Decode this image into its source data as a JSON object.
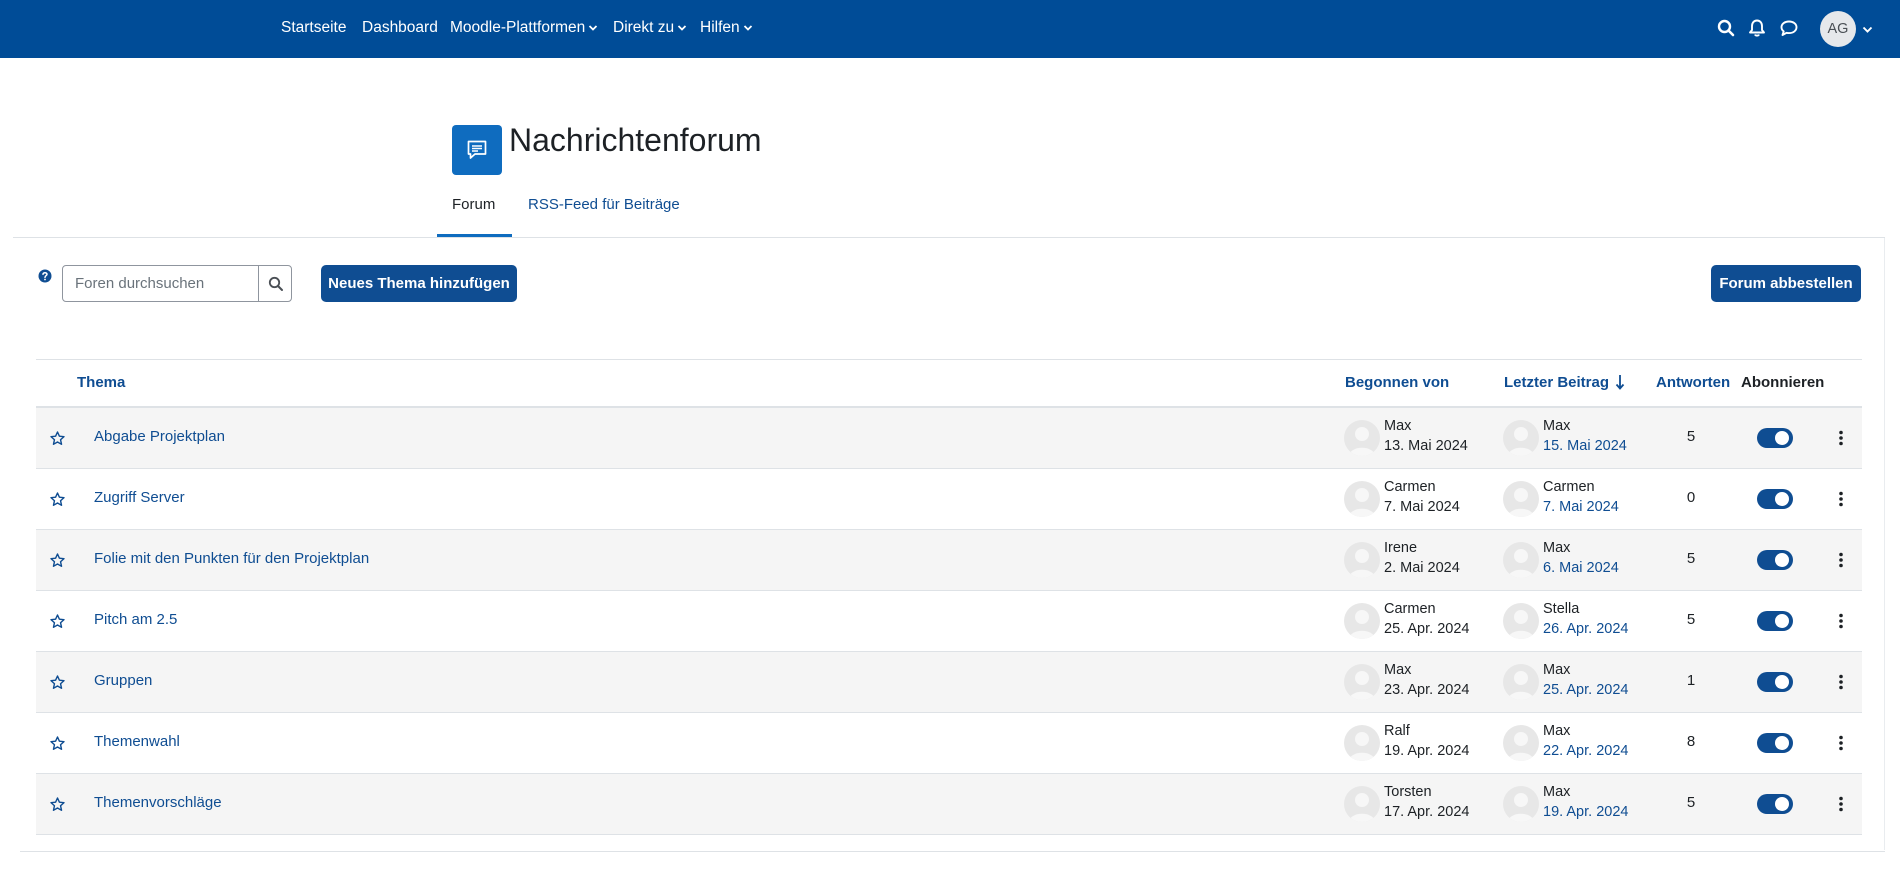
{
  "navbar": {
    "items": [
      {
        "label": "Startseite"
      },
      {
        "label": "Dashboard"
      },
      {
        "label": "Moodle-Plattformen"
      },
      {
        "label": "Direkt zu"
      },
      {
        "label": "Hilfen"
      }
    ],
    "user_initials": "AG",
    "icons": [
      "search-icon",
      "bell-icon",
      "chat-icon",
      "chevron-down-icon"
    ]
  },
  "header": {
    "title": "Nachrichtenforum",
    "icon": "forum-icon",
    "tabs": [
      {
        "label": "Forum",
        "active": true
      },
      {
        "label": "RSS-Feed für Beiträge",
        "active": false
      }
    ]
  },
  "toolbar": {
    "search_placeholder": "Foren durchsuchen",
    "new_topic_label": "Neues Thema hinzufügen",
    "unsubscribe_label": "Forum abbestellen"
  },
  "table": {
    "headers": {
      "topic": "Thema",
      "started_by": "Begonnen von",
      "last_post": "Letzter Beitrag",
      "replies": "Antworten",
      "subscribe": "Abonnieren"
    },
    "rows": [
      {
        "topic": "Abgabe Projektplan",
        "started_name": "Max",
        "started_date": "13. Mai 2024",
        "last_name": "Max",
        "last_date": "15. Mai 2024",
        "replies": "5",
        "subscribed": true
      },
      {
        "topic": "Zugriff Server",
        "started_name": "Carmen",
        "started_date": "7. Mai 2024",
        "last_name": "Carmen",
        "last_date": "7. Mai 2024",
        "replies": "0",
        "subscribed": true
      },
      {
        "topic": "Folie mit den Punkten für den Projektplan",
        "started_name": "Irene",
        "started_date": "2. Mai 2024",
        "last_name": "Max",
        "last_date": "6. Mai 2024",
        "replies": "5",
        "subscribed": true
      },
      {
        "topic": "Pitch am 2.5",
        "started_name": "Carmen",
        "started_date": "25. Apr. 2024",
        "last_name": "Stella",
        "last_date": "26. Apr. 2024",
        "replies": "5",
        "subscribed": true
      },
      {
        "topic": "Gruppen",
        "started_name": "Max",
        "started_date": "23. Apr. 2024",
        "last_name": "Max",
        "last_date": "25. Apr. 2024",
        "replies": "1",
        "subscribed": true
      },
      {
        "topic": "Themenwahl",
        "started_name": "Ralf",
        "started_date": "19. Apr. 2024",
        "last_name": "Max",
        "last_date": "22. Apr. 2024",
        "replies": "8",
        "subscribed": true
      },
      {
        "topic": "Themenvorschläge",
        "started_name": "Torsten",
        "started_date": "17. Apr. 2024",
        "last_name": "Max",
        "last_date": "19. Apr. 2024",
        "replies": "5",
        "subscribed": true
      }
    ]
  },
  "colors": {
    "navbar": "#004c97",
    "primary": "#0f4d92",
    "page_icon": "#0f6cbf",
    "row_stripe": "#f5f5f5"
  }
}
